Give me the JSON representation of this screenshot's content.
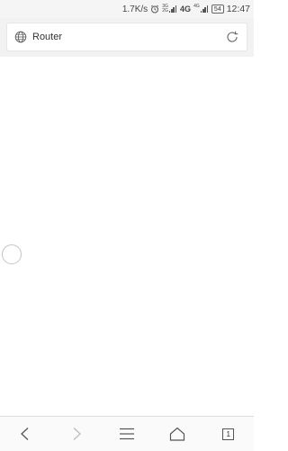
{
  "status_bar": {
    "speed": "1.7K/s",
    "network_1": "3G",
    "network_2": "2G",
    "network_type": "4G",
    "sim2_network": "4G",
    "battery": "54",
    "time": "12:47"
  },
  "address_bar": {
    "text": "Router"
  },
  "bottom_nav": {
    "tab_count": "1"
  },
  "icons": {
    "globe": "globe-icon",
    "refresh": "refresh-icon",
    "back": "back-arrow-icon",
    "forward": "forward-arrow-icon",
    "menu": "menu-icon",
    "home": "home-icon",
    "tabs": "tabs-icon",
    "alarm": "alarm-icon",
    "loading": "loading-spinner-icon"
  }
}
